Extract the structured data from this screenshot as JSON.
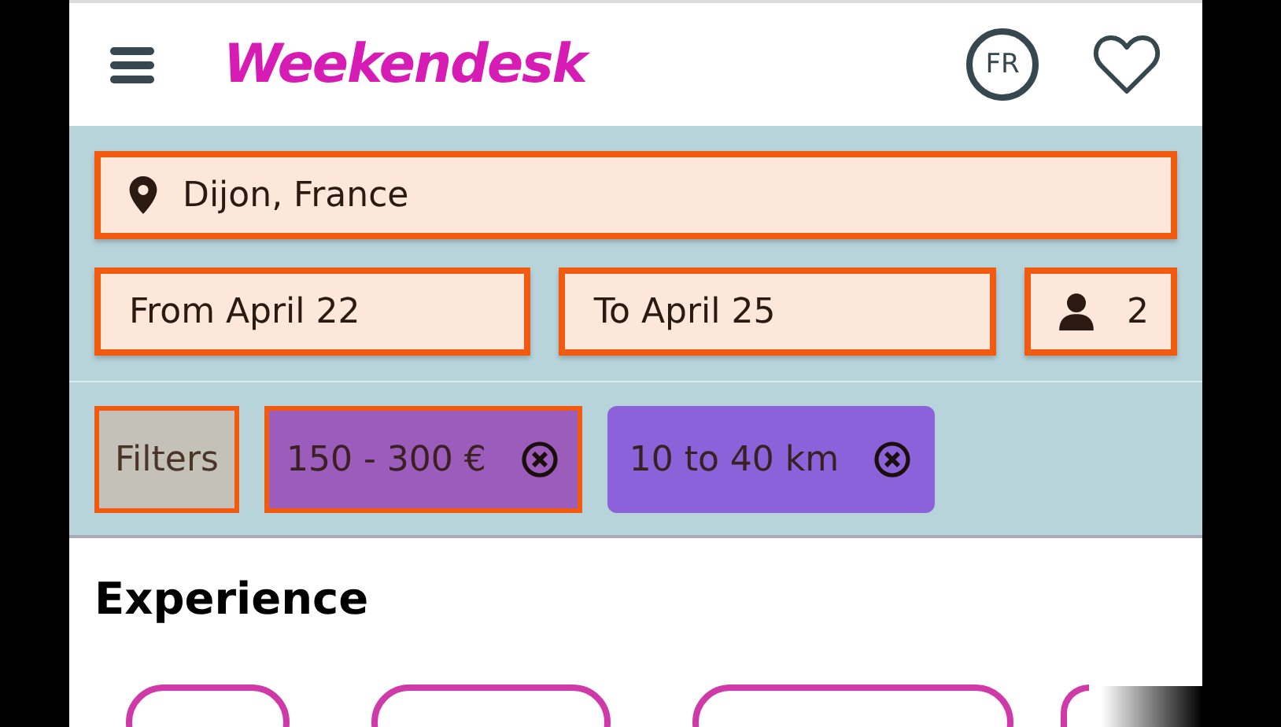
{
  "header": {
    "logo": "Weekendesk",
    "language": "FR"
  },
  "search": {
    "location": "Dijon, France",
    "from": "From April 22",
    "to": "To April 25",
    "guests": "2"
  },
  "filters": [
    {
      "kind": "button",
      "label": "Filters",
      "highlighted": true
    },
    {
      "kind": "chip",
      "label": "150 - 300 €",
      "highlighted": true
    },
    {
      "kind": "chip",
      "label": "10 to 40 km",
      "highlighted": false
    }
  ],
  "section": {
    "title": "Experience"
  }
}
